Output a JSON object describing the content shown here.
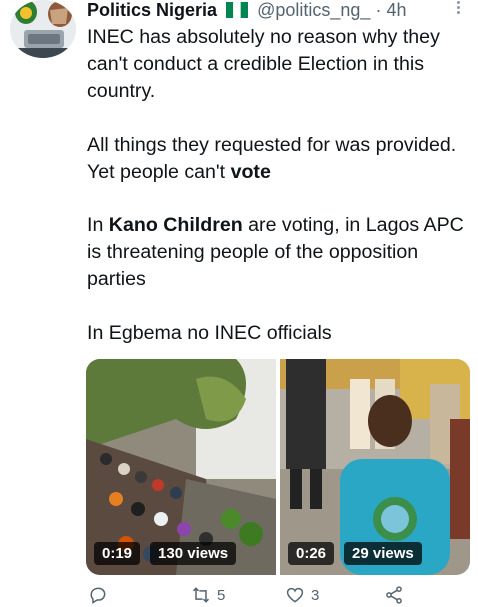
{
  "tweet": {
    "author_name": "Politics Nigeria",
    "handle": "@politics_ng_",
    "separator": "·",
    "time": "4h",
    "text": {
      "p1": "INEC has absolutely no reason why they can't conduct a credible Election in this country.",
      "p2_a": "All things they requested for was provided. Yet people can't ",
      "p2_b": "vote",
      "p3_a": "In ",
      "p3_b": "Kano Children",
      "p3_c": " are voting, in Lagos APC is threatening people of the opposition parties",
      "p4": "In Egbema no INEC officials"
    }
  },
  "videos": [
    {
      "duration": "0:19",
      "views": "130 views"
    },
    {
      "duration": "0:26",
      "views": "29 views"
    }
  ],
  "actions": {
    "replies": "",
    "retweets": "5",
    "likes": "3"
  },
  "icons": {
    "reply": "reply-icon",
    "retweet": "retweet-icon",
    "like": "heart-icon",
    "share": "share-icon",
    "more": "more-icon"
  },
  "colors": {
    "text": "#0f1419",
    "muted": "#536471",
    "flag_green": "#008751"
  }
}
